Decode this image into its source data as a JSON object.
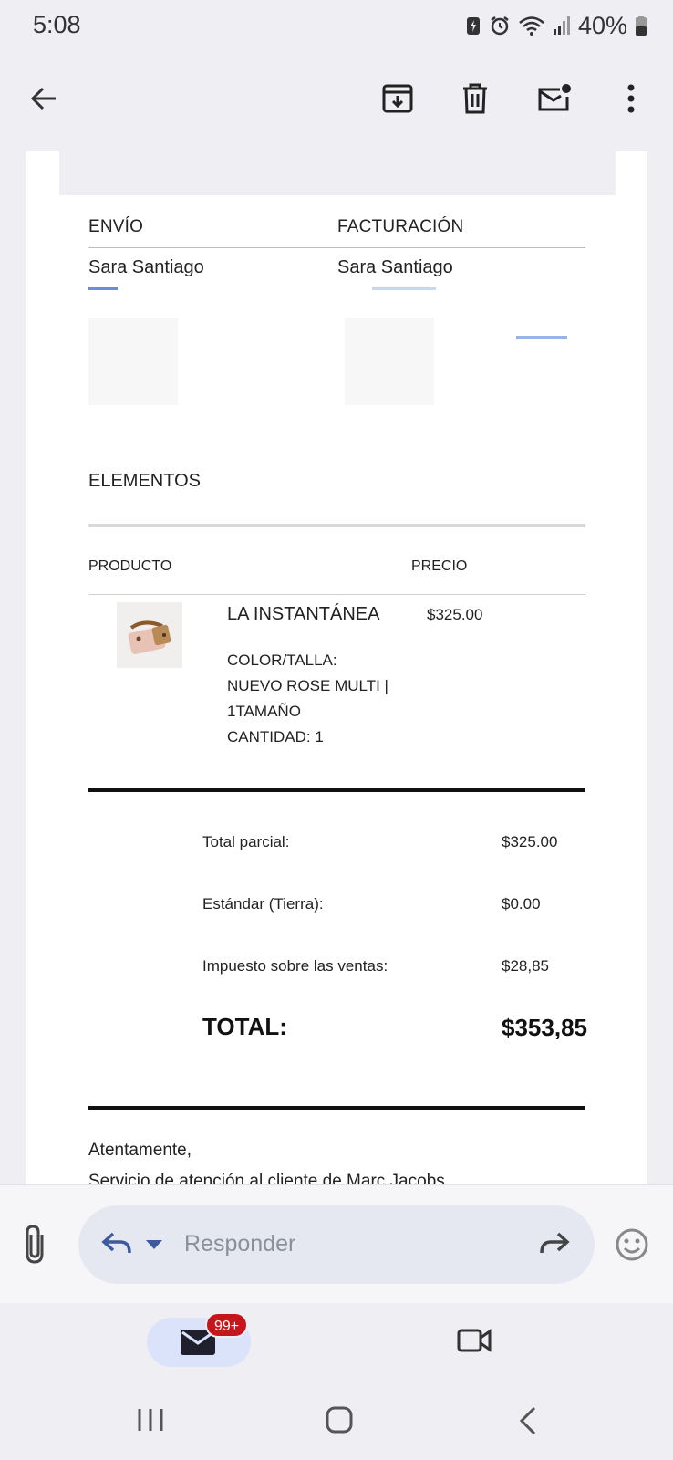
{
  "status_bar": {
    "time": "5:08",
    "battery": "40%"
  },
  "toolbar": {
    "back_icon": "arrow-left-icon",
    "archive_icon": "archive-icon",
    "delete_icon": "trash-icon",
    "unread_icon": "mark-unread-icon",
    "more_icon": "more-vert-icon"
  },
  "email": {
    "shipping_heading": "ENVÍO",
    "billing_heading": "FACTURACIÓN",
    "shipping_name": "Sara Santiago",
    "billing_name": "Sara Santiago",
    "items_heading": "ELEMENTOS",
    "col_product": "PRODUCTO",
    "col_price": "PRECIO",
    "product": {
      "name": "LA INSTANTÁNEA",
      "price": "$325.00",
      "color_size_label": "COLOR/TALLA:",
      "color_value": "NUEVO ROSE MULTI |",
      "size_value": "1TAMAÑO",
      "quantity": "CANTIDAD: 1"
    },
    "summary": {
      "subtotal_label": "Total parcial:",
      "subtotal_value": "$325.00",
      "shipping_label": "Estándar (Tierra):",
      "shipping_value": "$0.00",
      "tax_label": "Impuesto sobre las ventas:",
      "tax_value": "$28,85",
      "total_label": "TOTAL:",
      "total_value": "$353,85"
    },
    "sign_off": "Atentamente,",
    "signature_partial": "Servicio de atención al cliente de Marc Jacobs"
  },
  "reply_bar": {
    "placeholder": "Responder"
  },
  "bottom_nav": {
    "mail_badge": "99+"
  },
  "colors": {
    "accent": "#3c5aa0",
    "badge": "#c5161c",
    "pill": "#e5e8f1"
  }
}
